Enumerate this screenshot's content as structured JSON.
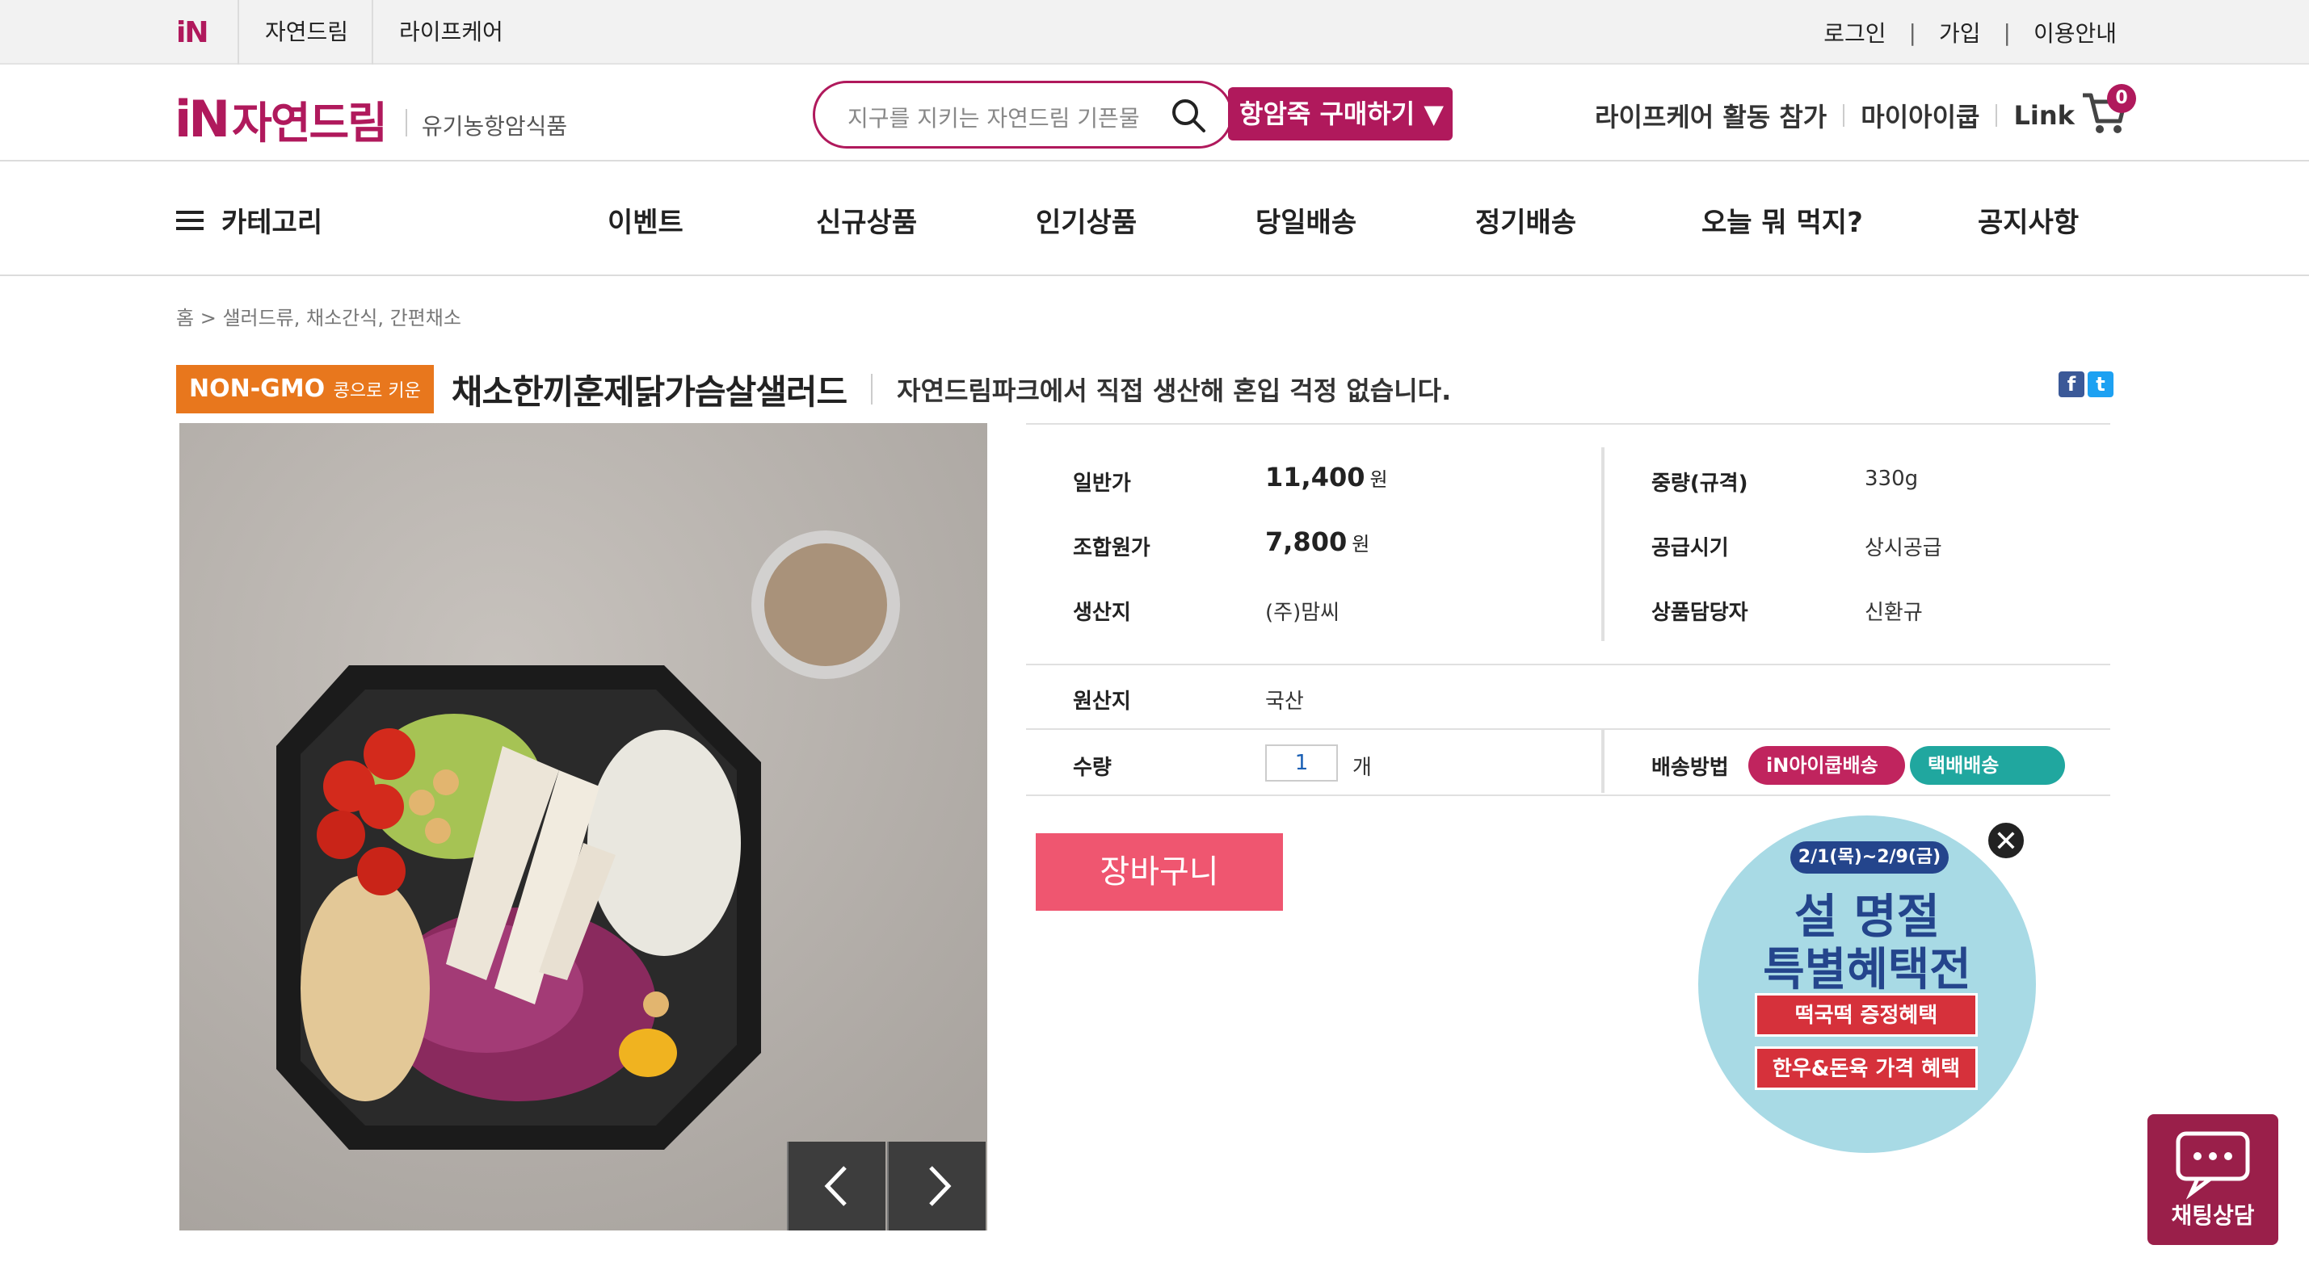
{
  "topbar": {
    "logo": "iN",
    "tabs": [
      "자연드림",
      "라이프케어"
    ],
    "links": [
      "로그인",
      "가입",
      "이용안내"
    ],
    "separator": "|"
  },
  "header": {
    "logo_mark": "iN",
    "logo_name": "자연드림",
    "logo_sub": "유기농항암식품",
    "search_placeholder": "지구를 지키는 자연드림 기픈물",
    "cta_button": "항암죽 구매하기 ▼",
    "right_links": [
      "라이프케어 활동 참가",
      "마이아이쿱",
      "Link"
    ],
    "cart_count": "0"
  },
  "nav": {
    "category": "카테고리",
    "items": [
      "이벤트",
      "신규상품",
      "인기상품",
      "당일배송",
      "정기배송",
      "오늘 뭐 먹지?",
      "공지사항"
    ]
  },
  "breadcrumb": "홈 > 샐러드류, 채소간식, 간편채소",
  "product": {
    "badge_main": "NON-GMO",
    "badge_sub": "콩으로 키운",
    "title": "채소한끼훈제닭가슴살샐러드",
    "description": "자연드림파크에서 직접 생산해 혼입 걱정 없습니다.",
    "sns": [
      "f",
      "t"
    ]
  },
  "info": {
    "regular_price_label": "일반가",
    "regular_price": "11,400",
    "member_price_label": "조합원가",
    "member_price": "7,800",
    "currency": "원",
    "producer_label": "생산지",
    "producer": "(주)맘씨",
    "weight_label": "중량(규격)",
    "weight": "330g",
    "supply_label": "공급시기",
    "supply": "상시공급",
    "manager_label": "상품담당자",
    "manager": "신환규",
    "origin_label": "원산지",
    "origin": "국산",
    "qty_label": "수량",
    "qty_value": "1",
    "qty_unit": "개",
    "delivery_label": "배송방법",
    "delivery_options": [
      "iN아이쿱배송",
      "택배배송"
    ]
  },
  "cart_button": "장바구니",
  "promo": {
    "date": "2/1(목)~2/9(금)",
    "line1": "설 명절",
    "line2": "특별혜택전",
    "benefit1": "떡국떡 증정혜택",
    "benefit2": "한우&돈육 가격 혜택",
    "close": "✕"
  },
  "chat": {
    "label": "채팅상담"
  },
  "colors": {
    "brand": "#b0195c",
    "nongmo": "#e8771d",
    "cart_button": "#ef5670",
    "icoop_pill": "#c0245e",
    "parcel_pill": "#20a79f"
  }
}
